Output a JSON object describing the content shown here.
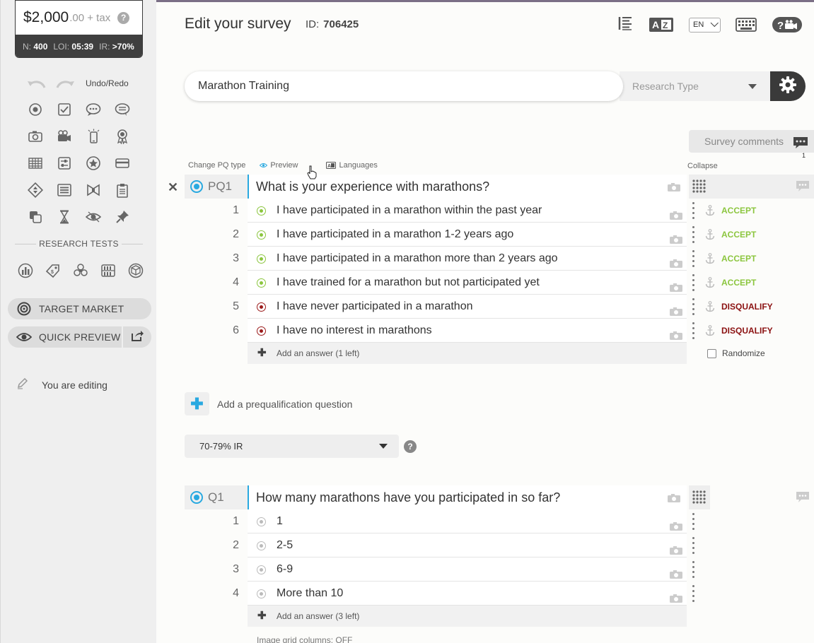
{
  "sidebar": {
    "price_main": "$2,000",
    "price_sub": ".00 + tax",
    "help": "?",
    "stats": {
      "n_label": "N:",
      "n_value": "400",
      "loi_label": "LOI:",
      "loi_value": "05:39",
      "ir_label": "IR:",
      "ir_value": ">70%"
    },
    "undo_redo_label": "Undo/Redo",
    "tool_icons": [
      "single-choice-icon",
      "multi-choice-icon",
      "open-text-icon",
      "comment-icon",
      "photo-icon",
      "video-icon",
      "mobile-icon",
      "award-icon",
      "grid-icon",
      "sliders-icon",
      "star-rating-icon",
      "card-icon",
      "ranking-icon",
      "list-icon",
      "bow-tie-icon",
      "clipboard-icon",
      "cards-icon",
      "hourglass-icon",
      "eye-tracking-icon",
      "pin-icon"
    ],
    "research_tests_label": "RESEARCH TESTS",
    "research_icons": [
      "bar-chart-icon",
      "price-tag-icon",
      "conjoint-icon",
      "shelf-icon",
      "package-icon"
    ],
    "target_market_label": "TARGET MARKET",
    "quick_preview_label": "QUICK PREVIEW",
    "editing_label": "You are editing"
  },
  "header": {
    "title": "Edit your survey",
    "id_label": "ID:",
    "id_value": "706425",
    "language": "EN",
    "icons": [
      "outline-icon",
      "translate-icon",
      "keyboard-icon",
      "help-video-icon"
    ]
  },
  "survey": {
    "name": "Marathon Training",
    "research_type_placeholder": "Research Type",
    "comments_label": "Survey comments",
    "comments_count": "1"
  },
  "pq_toolbar": {
    "change_type": "Change PQ type",
    "preview": "Preview",
    "languages": "Languages",
    "collapse": "Collapse"
  },
  "pq1": {
    "code": "PQ1",
    "text": "What is your experience with marathons?",
    "answers": [
      {
        "num": "1",
        "text": "I have participated in a marathon within the past year",
        "status": "ACCEPT"
      },
      {
        "num": "2",
        "text": "I have participated in a marathon 1-2 years ago",
        "status": "ACCEPT"
      },
      {
        "num": "3",
        "text": "I have participated in a marathon more than 2 years ago",
        "status": "ACCEPT"
      },
      {
        "num": "4",
        "text": "I have trained for a marathon but not participated yet",
        "status": "ACCEPT"
      },
      {
        "num": "5",
        "text": "I have never participated in a marathon",
        "status": "DISQUALIFY"
      },
      {
        "num": "6",
        "text": "I have no interest in marathons",
        "status": "DISQUALIFY"
      }
    ],
    "add_answer": "Add an answer (1 left)",
    "randomize": "Randomize"
  },
  "add_prequal": "Add a prequalification question",
  "ir_select": "70-79% IR",
  "q1": {
    "code": "Q1",
    "text": "How many marathons have you participated in so far?",
    "answers": [
      {
        "num": "1",
        "text": "1"
      },
      {
        "num": "2",
        "text": "2-5"
      },
      {
        "num": "3",
        "text": "6-9"
      },
      {
        "num": "4",
        "text": "More than 10"
      }
    ],
    "add_answer": "Add an answer (3 left)",
    "image_grid": "Image grid columns: OFF"
  },
  "colors": {
    "accent_blue": "#29a9e0",
    "accept_green": "#8cc63f",
    "disqualify_red": "#8b1111",
    "dark": "#3a3a3a"
  }
}
